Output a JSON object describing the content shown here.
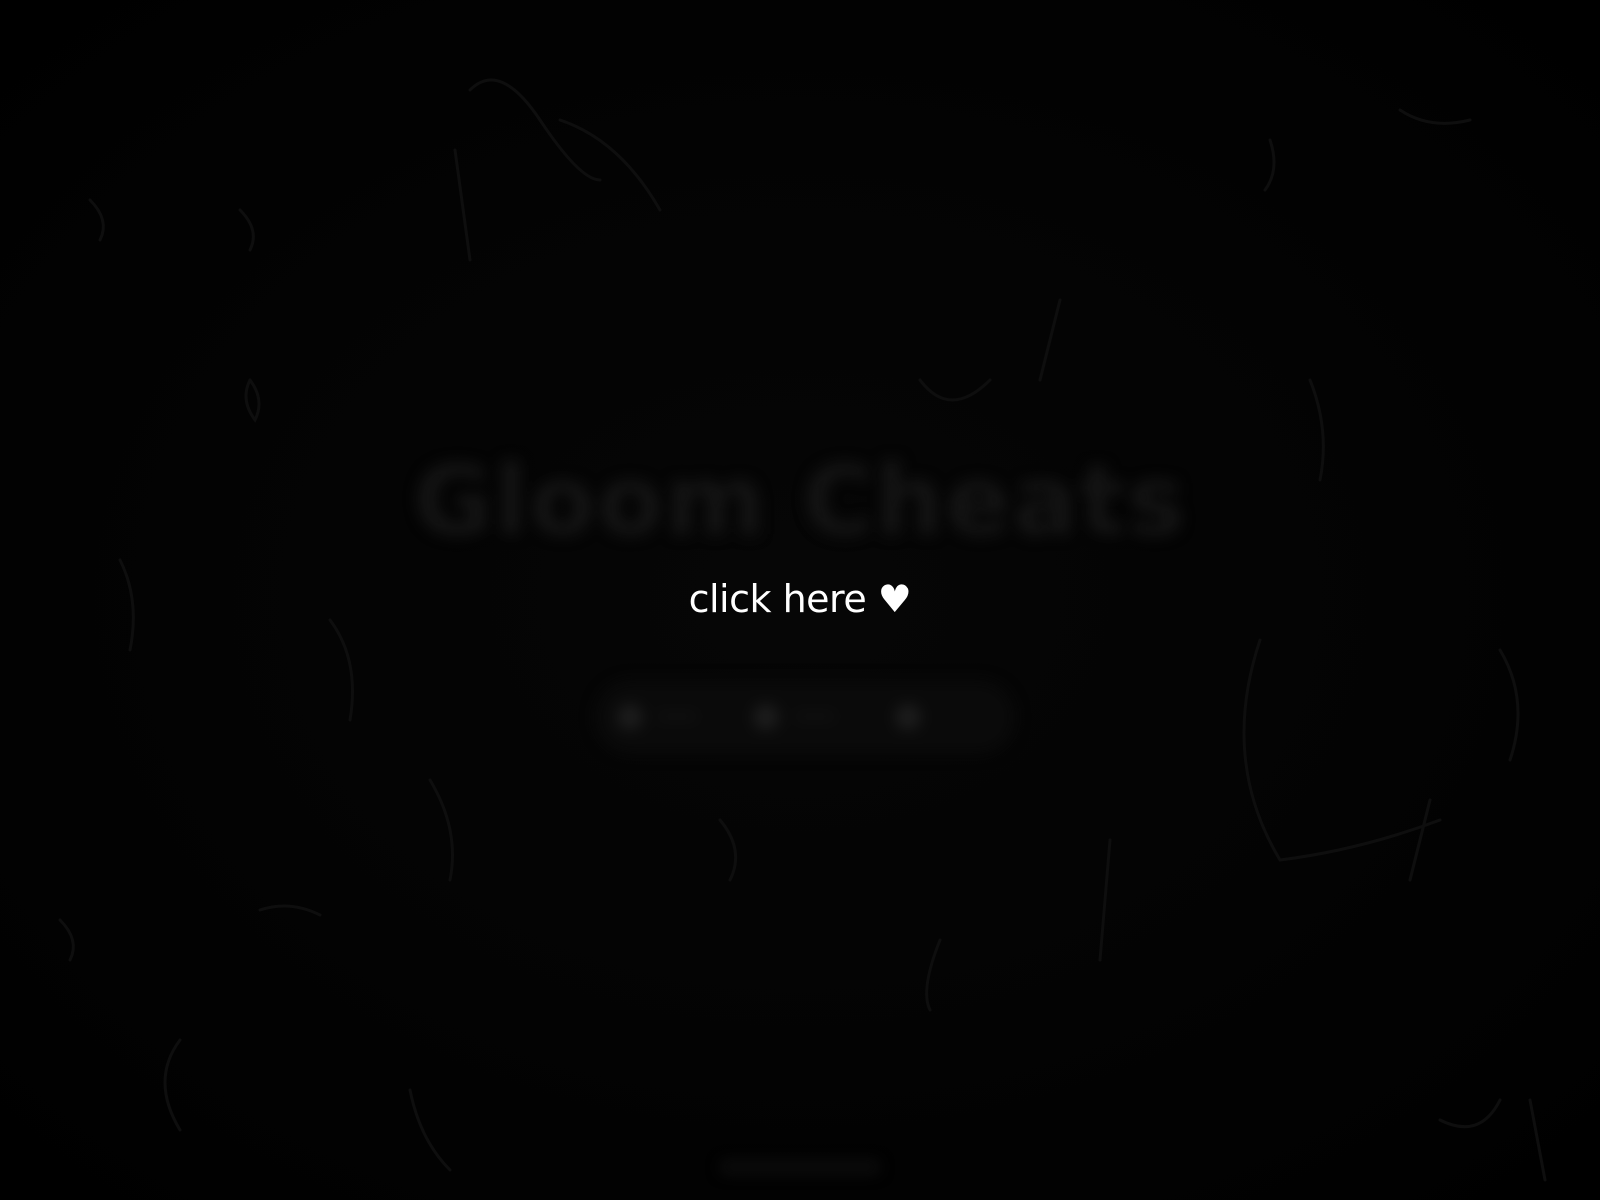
{
  "site": {
    "title": "Gloom Cheats"
  },
  "overlay": {
    "prompt": "click here ♥"
  },
  "colors": {
    "background": "#000000",
    "prompt_text": "#ffffff",
    "blurred_text": "#141414"
  }
}
